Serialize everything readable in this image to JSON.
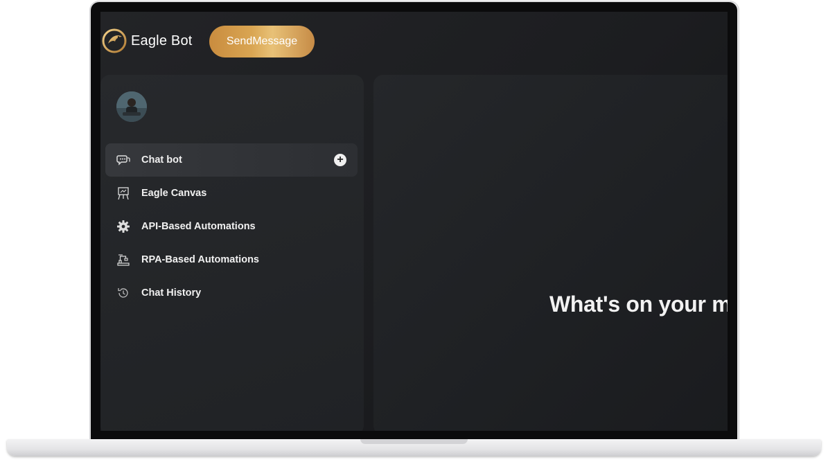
{
  "header": {
    "app_name": "Eagle Bot",
    "send_button": "SendMessage",
    "logo_icon": "eagle-logo-icon"
  },
  "sidebar": {
    "items": [
      {
        "label": "Chat bot",
        "icon": "chat-bubbles-icon",
        "active": true
      },
      {
        "label": "Eagle Canvas",
        "icon": "presentation-board-icon",
        "active": false
      },
      {
        "label": "API-Based Automations",
        "icon": "gear-icon",
        "active": false
      },
      {
        "label": "RPA-Based Automations",
        "icon": "robot-arm-icon",
        "active": false
      },
      {
        "label": "Chat History",
        "icon": "history-icon",
        "active": false
      }
    ]
  },
  "main": {
    "headline": "What's on your m"
  },
  "colors": {
    "accent_gold": "#d9a552",
    "background": "#1e2023",
    "panel": "#25272a"
  }
}
